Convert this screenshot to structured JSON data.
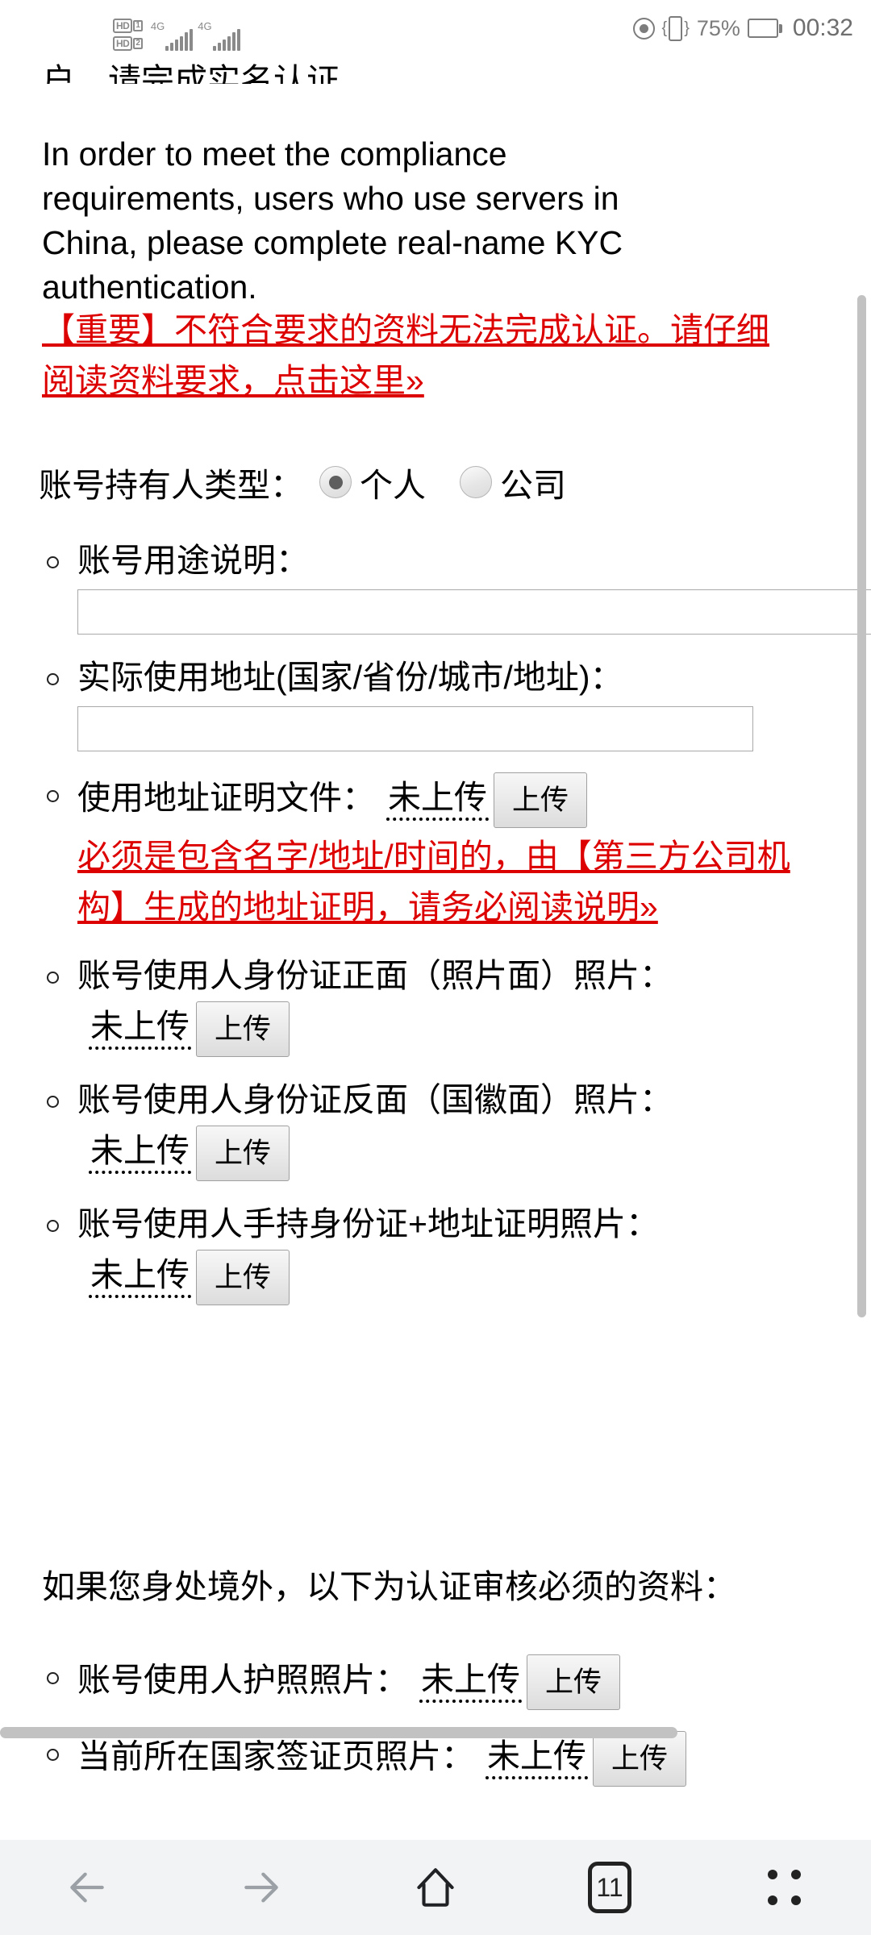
{
  "status_bar": {
    "sim1_label": "HD",
    "sim1_index": "1",
    "sim2_label": "HD",
    "sim2_index": "2",
    "network1": "4G",
    "network2": "4G",
    "battery_percent": "75%",
    "clock": "00:32",
    "icons": [
      "eye-icon",
      "vibrate-icon",
      "battery-icon"
    ]
  },
  "page": {
    "truncated_top_line": "户，请完成实名认证。",
    "english_paragraph": "In order to meet the compliance requirements, users who use servers in China, please complete real-name KYC authentication.",
    "important_link": "【重要】不符合要求的资料无法完成认证。请仔细阅读资料要求，点击这里»",
    "holder_type_label": "账号持有人类型：",
    "holder_options": [
      {
        "label": "个人",
        "selected": true
      },
      {
        "label": "公司",
        "selected": false
      }
    ],
    "fields": [
      {
        "label": "账号用途说明：",
        "type": "text",
        "value": "",
        "placeholder": ""
      },
      {
        "label": "实际使用地址(国家/省份/城市/地址)：",
        "type": "text",
        "value": "",
        "placeholder": ""
      },
      {
        "label": "使用地址证明文件：",
        "type": "upload",
        "status": "未上传",
        "button": "上传",
        "note": "必须是包含名字/地址/时间的，由【第三方公司机构】生成的地址证明，请务必阅读说明»"
      },
      {
        "label": "账号使用人身份证正面（照片面）照片：",
        "type": "upload",
        "status": "未上传",
        "button": "上传"
      },
      {
        "label": "账号使用人身份证反面（国徽面）照片：",
        "type": "upload",
        "status": "未上传",
        "button": "上传"
      },
      {
        "label": "账号使用人手持身份证+地址证明照片：",
        "type": "upload",
        "status": "未上传",
        "button": "上传"
      }
    ],
    "overseas_paragraph": "如果您身处境外，以下为认证审核必须的资料：",
    "overseas_fields": [
      {
        "label": "账号使用人护照照片：",
        "type": "upload",
        "status": "未上传",
        "button": "上传"
      },
      {
        "label": "当前所在国家签证页照片：",
        "type": "upload",
        "status": "未上传",
        "button": "上传"
      }
    ]
  },
  "bottom_nav": {
    "back": "back-arrow-icon",
    "forward": "forward-arrow-icon",
    "home": "home-icon",
    "tabs_count": "11",
    "menu": "menu-icon"
  },
  "colors": {
    "link_red": "#dd0000",
    "nav_bg": "#f1f3f4",
    "scrollbar": "#c2c2c2"
  }
}
